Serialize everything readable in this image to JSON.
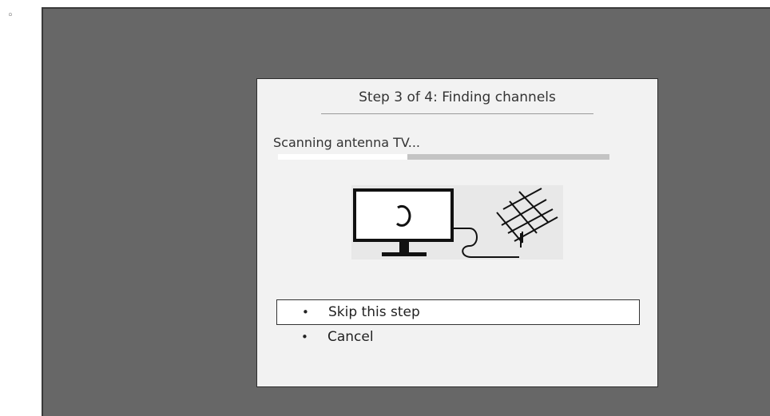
{
  "list_bullet": "◦",
  "dialog": {
    "title": "Step 3 of 4: Finding channels",
    "status": "Scanning antenna TV...",
    "progress": 0.39,
    "illustration": {
      "icons": [
        "tv-icon",
        "loading-spinner-icon",
        "antenna-icon"
      ]
    },
    "menu": [
      {
        "label": "Skip this step",
        "bullet": "•",
        "selected": true
      },
      {
        "label": "Cancel",
        "bullet": "•",
        "selected": false
      }
    ]
  },
  "colors": {
    "screen_background": "#676767",
    "dialog_background": "#f2f2f2",
    "progress_track": "#c4c4c4",
    "progress_fill": "#ffffff"
  }
}
